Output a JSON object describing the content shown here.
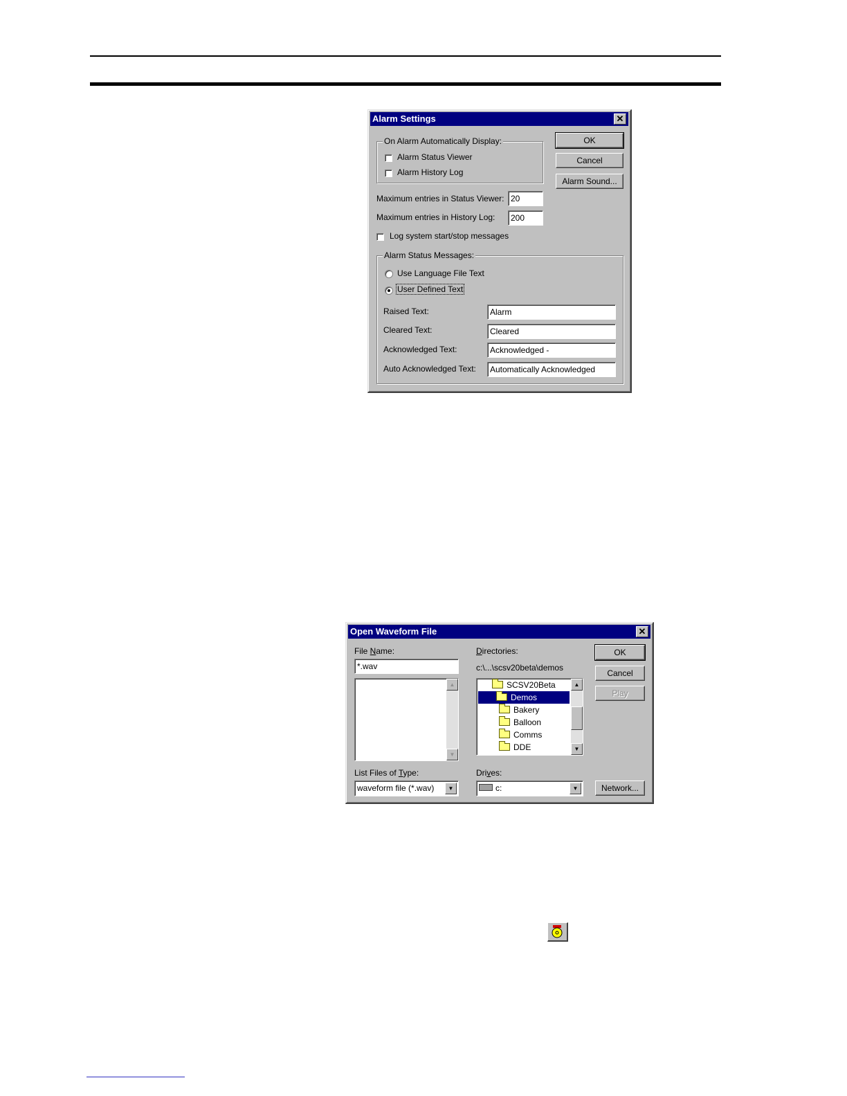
{
  "alarm_settings": {
    "title": "Alarm Settings",
    "auto_display_group": "On Alarm Automatically Display:",
    "status_viewer_label": "Alarm Status Viewer",
    "history_log_label": "Alarm History Log",
    "max_status_label": "Maximum entries in Status Viewer:",
    "max_status_value": "20",
    "max_history_label": "Maximum entries in History Log:",
    "max_history_value": "200",
    "log_system_label": "Log system start/stop messages",
    "status_messages_group": "Alarm Status Messages:",
    "use_language_label": "Use Language File Text",
    "user_defined_label": "User Defined Text",
    "raised_label": "Raised Text:",
    "raised_value": "Alarm",
    "cleared_label": "Cleared Text:",
    "cleared_value": "Cleared",
    "acknowledged_label": "Acknowledged Text:",
    "acknowledged_value": "Acknowledged -",
    "auto_ack_label": "Auto Acknowledged Text:",
    "auto_ack_value": "Automatically Acknowledged",
    "ok_label": "OK",
    "cancel_label": "Cancel",
    "sound_label": "Alarm Sound..."
  },
  "open_waveform": {
    "title": "Open Waveform File",
    "file_name_label_pre": "File ",
    "file_name_label_ul": "N",
    "file_name_label_post": "ame:",
    "file_name_value": "*.wav",
    "directories_label_ul": "D",
    "directories_label_post": "irectories:",
    "current_path": "c:\\...\\scsv20beta\\demos",
    "directories": [
      "SCSV20Beta",
      "Demos",
      "Bakery",
      "Balloon",
      "Comms",
      "DDE"
    ],
    "list_type_label_pre": "List Files of ",
    "list_type_label_ul": "T",
    "list_type_label_post": "ype:",
    "list_type_value": "waveform file (*.wav)",
    "drives_label_pre": "Dri",
    "drives_label_ul": "v",
    "drives_label_post": "es:",
    "drives_value": "c:",
    "ok_label": "OK",
    "cancel_label": "Cancel",
    "play_label": "Play",
    "network_label": "Network..."
  }
}
